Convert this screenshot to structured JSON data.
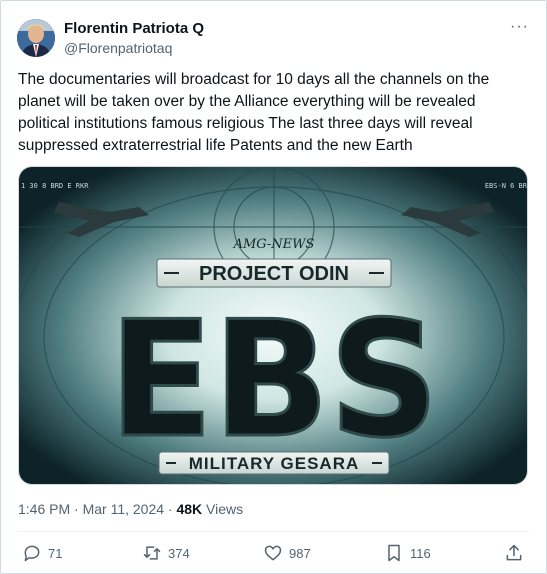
{
  "tweet": {
    "author_name": "Florentin Patriota Q",
    "author_handle": "@Florenpatriotaq",
    "more_label": "···",
    "text": "The documentaries will broadcast for 10 days all the channels on the planet will be taken over by the Alliance everything will be revealed political institutions famous religious The last three days will reveal suppressed extraterrestrial life Patents and the new Earth",
    "timestamp": "1:46 PM · Mar 11, 2024 · ",
    "views_count": "48K",
    "views_label": " Views"
  },
  "image": {
    "watermark": "AMG-NEWS",
    "title": "PROJECT ODIN",
    "big_text": "EBS",
    "subtitle": "MILITARY GESARA",
    "corner_left": "1 30 8 BRD E RKR",
    "corner_right": "EBS-N 6 BR"
  },
  "actions": {
    "replies": "71",
    "reposts": "374",
    "likes": "987",
    "bookmarks": "116"
  },
  "colors": {
    "text_primary": "#0f1419",
    "text_secondary": "#536471",
    "border": "#cfd9de",
    "image_glow": "#cfe6e2"
  }
}
